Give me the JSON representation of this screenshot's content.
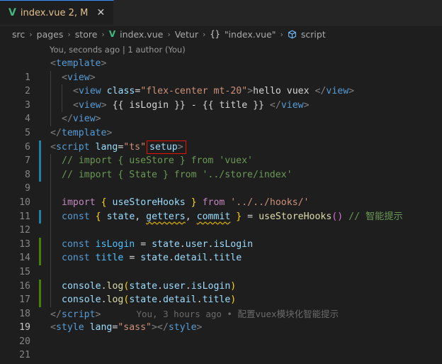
{
  "tab": {
    "name": "index.vue",
    "status": "2, M",
    "close_glyph": "✕",
    "icon": "vue-file-icon"
  },
  "breadcrumb": {
    "items": [
      "src",
      "pages",
      "store",
      "index.vue",
      "Vetur",
      "\"index.vue\"",
      "script"
    ],
    "separator": "›",
    "braces": "{}"
  },
  "blame": {
    "header": "You, seconds ago | 1 author (You)",
    "inline": "You, 3 hours ago • 配置vuex模块化智能提示"
  },
  "code": {
    "line_numbers": [
      "1",
      "2",
      "3",
      "4",
      "5",
      "6",
      "7",
      "8",
      "9",
      "10",
      "11",
      "12",
      "13",
      "14",
      "15",
      "16",
      "17",
      "18",
      "19",
      "20",
      "21"
    ],
    "l1": {
      "open": "<",
      "tag": "template",
      "close": ">"
    },
    "l2": {
      "open": "<",
      "tag": "view",
      "close": ">"
    },
    "l3": {
      "open": "<",
      "tag": "view",
      "attr": "class",
      "eq": "=",
      "val": "\"flex-center mt-20\"",
      "close": ">",
      "text": "hello vuex ",
      "end_open": "</",
      "end_tag": "view",
      "end_close": ">"
    },
    "l4": {
      "open": "<",
      "tag": "view",
      "close": ">",
      "text": " {{ isLogin }} - {{ title }} ",
      "end_open": "</",
      "end_tag": "view",
      "end_close": ">"
    },
    "l5": {
      "end_open": "</",
      "end_tag": "view",
      "end_close": ">"
    },
    "l6": {
      "end_open": "</",
      "end_tag": "template",
      "end_close": ">"
    },
    "l7": {
      "open": "<",
      "tag": "script",
      "attr": "lang",
      "eq": "=",
      "val": "\"ts\"",
      "setup": "setup",
      "close": ">"
    },
    "l8": "// import { useStore } from 'vuex'",
    "l9": "// import { State } from '../store/index'",
    "l11": {
      "kw": "import",
      "b1": "{",
      "name": "useStoreHooks",
      "b2": "}",
      "from": "from",
      "path": "'../../hooks/'"
    },
    "l12": {
      "kw": "const",
      "b1": "{",
      "v1": "state",
      "comma1": ",",
      "v2": "getters",
      "comma2": ",",
      "v3": "commit",
      "b2": "}",
      "eq": "=",
      "fn": "useStoreHooks",
      "parens": "()",
      "comment": "// 智能提示"
    },
    "l14": {
      "kw": "const",
      "name": "isLogin",
      "eq": "=",
      "o1": "state",
      "d1": ".",
      "o2": "user",
      "d2": ".",
      "o3": "isLogin"
    },
    "l15": {
      "kw": "const",
      "name": "title",
      "eq": "=",
      "o1": "state",
      "d1": ".",
      "o2": "detail",
      "d2": ".",
      "o3": "title"
    },
    "l17": {
      "obj": "console",
      "d1": ".",
      "fn": "log",
      "p1": "(",
      "a1": "state",
      "d2": ".",
      "a2": "user",
      "d3": ".",
      "a3": "isLogin",
      "p2": ")"
    },
    "l18": {
      "obj": "console",
      "d1": ".",
      "fn": "log",
      "p1": "(",
      "a1": "state",
      "d2": ".",
      "a2": "detail",
      "d3": ".",
      "a3": "title",
      "p2": ")"
    },
    "l19": {
      "end_open": "</",
      "end_tag": "script",
      "end_close": ">"
    },
    "l20": {
      "open": "<",
      "tag": "style",
      "attr": "lang",
      "eq": "=",
      "val": "\"sass\"",
      "close": ">",
      "end_open": "</",
      "end_tag": "style",
      "end_close": ">"
    }
  },
  "colors": {
    "background": "#1e1e1e",
    "modified_gutter": "#1b81a8",
    "added_gutter": "#487e02",
    "highlight_box": "#e51400"
  }
}
